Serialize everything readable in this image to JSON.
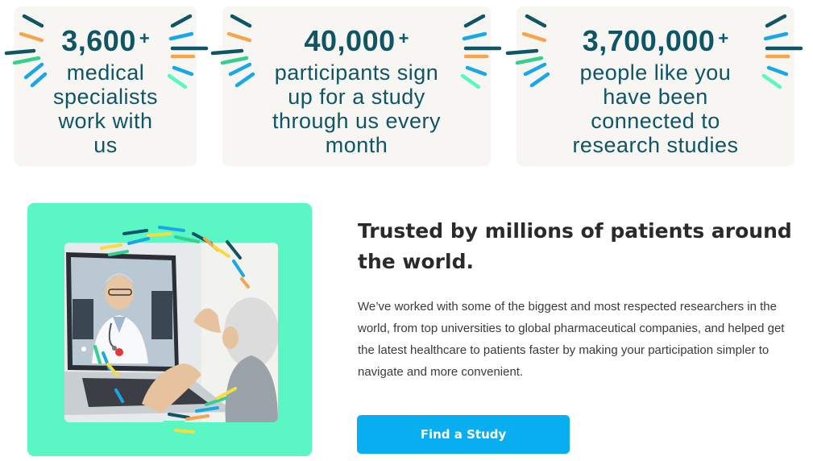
{
  "stats": [
    {
      "number": "3,600",
      "plus": "+",
      "description": "medical specialists work with us"
    },
    {
      "number": "40,000",
      "plus": "+",
      "description": "participants sign up for a study through us every month"
    },
    {
      "number": "3,700,000",
      "plus": "+",
      "description": "people like you have been connected to research studies"
    }
  ],
  "feature": {
    "headline": "Trusted by millions of patients around the world.",
    "body": "We’ve worked with some of the biggest and most respected researchers in the world, from top universities to global pharmaceutical companies, and helped get the latest healthcare to patients faster by making your participation simpler to navigate and more convenient.",
    "cta_label": "Find a Study"
  },
  "colors": {
    "navy": "#0e5566",
    "card_bg": "#f7f6f3",
    "mint": "#5af6c3",
    "cta_blue": "#08aef0",
    "orange": "#f6a54a",
    "sky": "#1aa7e8",
    "green": "#35d08f",
    "yellow": "#f7dc3d"
  },
  "icons": {
    "burst": "confetti-burst-icon",
    "photo": "telehealth-video-call-photo"
  }
}
